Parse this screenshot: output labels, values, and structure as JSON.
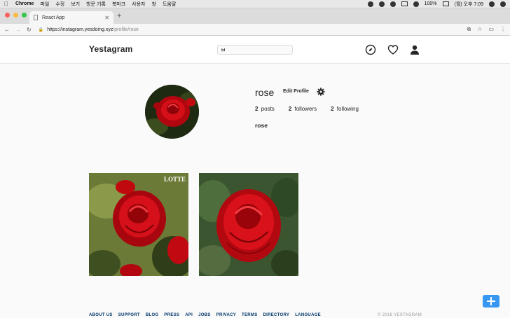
{
  "os_menu": {
    "app": "Chrome",
    "items": [
      "파일",
      "수정",
      "보기",
      "방문 기록",
      "북마크",
      "사용자",
      "창",
      "도움말"
    ],
    "battery": "100%",
    "clock": "(월) 오후 7:09"
  },
  "browser": {
    "tab_title": "React App",
    "url_host": "https://instagram.yesdoing.xyz",
    "url_path": "/profile/rose"
  },
  "header": {
    "brand": "Yestagram",
    "search_value": "ㅂ",
    "icons": [
      "compass-icon",
      "heart-icon",
      "person-icon"
    ]
  },
  "profile": {
    "username": "rose",
    "edit_label": "Edit Profile",
    "posts_count": "2",
    "posts_label": "posts",
    "followers_count": "2",
    "followers_label": "followers",
    "following_count": "2",
    "following_label": "following",
    "full_name": "rose"
  },
  "posts": [
    {
      "watermark": "LOTTE"
    },
    {
      "watermark": ""
    }
  ],
  "footer": {
    "links": [
      "ABOUT US",
      "SUPPORT",
      "BLOG",
      "PRESS",
      "API",
      "JOBS",
      "PRIVACY",
      "TERMS",
      "DIRECTORY",
      "LANGUAGE"
    ],
    "copyright": "© 2018 YESTAGRAM"
  },
  "colors": {
    "accent": "#3897f0",
    "link": "#00376b",
    "rose": "#d10a14"
  }
}
